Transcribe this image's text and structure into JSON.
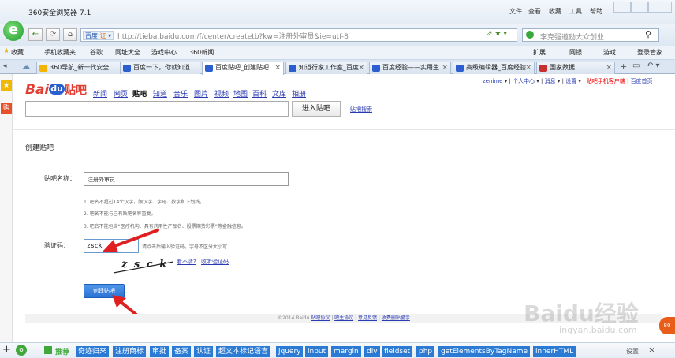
{
  "browser": {
    "title": "360安全浏览器 7.1",
    "menu": [
      "文件",
      "查看",
      "收藏",
      "工具",
      "帮助"
    ],
    "address_prefix": "百度",
    "address_url": "http://tieba.baidu.com/f/center/createtb?kw=注册外审员&ie=utf-8",
    "search_text": "李克强邀励大众创业",
    "favorites": [
      "收藏",
      "手机收藏夹",
      "谷歌",
      "网址大全",
      "游戏中心",
      "360新闻"
    ],
    "fav_right": [
      "扩展",
      "网银",
      "游戏",
      "登录管家"
    ],
    "tabs": [
      {
        "label": "360导航_新一代安全",
        "active": false
      },
      {
        "label": "百度一下，你就知道",
        "active": false
      },
      {
        "label": "百度贴吧_创建贴吧",
        "active": true
      },
      {
        "label": "知道行家工作室_百度",
        "active": false
      },
      {
        "label": "百度经验——实用生",
        "active": false
      },
      {
        "label": "高级编辑器_百度经验",
        "active": false
      },
      {
        "label": "国家数据",
        "active": false
      }
    ]
  },
  "header": {
    "logo_bai": "Bai",
    "logo_du": "du",
    "logo_tieba": "贴吧",
    "user": "zenime",
    "links": [
      "个人中心",
      "消息",
      "设置"
    ],
    "red_link": "贴吧手机客户端",
    "home": "百度首页",
    "nav": [
      "新闻",
      "网页",
      "贴吧",
      "知道",
      "音乐",
      "图片",
      "视频",
      "地图",
      "百科",
      "文库",
      "相册"
    ],
    "active_nav": "贴吧",
    "enter_button": "进入贴吧",
    "search_link": "贴吧搜索"
  },
  "form": {
    "section_title": "创建贴吧",
    "name_label": "贴吧名称：",
    "name_value": "注册外审员",
    "rules": [
      "1. 吧名不超过14个汉字，限汉字、字母、数字和下划线。",
      "2. 吧名不能与已有贴吧名称重复。",
      "3. 吧名不能包含“医疗机构、具有药用性产品名、股票期货彩票”等金融信息。"
    ],
    "captcha_label": "验证码：",
    "captcha_value": "zsck",
    "captcha_hint": "请点击后输入验证码，字母不区分大小写",
    "captcha_image_text": "z s c k",
    "unclear_link": "看不清?",
    "listen_link": "收听验证码",
    "submit": "创建贴吧"
  },
  "footer": {
    "copyright": "©2014 Baidu",
    "links": [
      "贴吧协议",
      "吧主协议",
      "意见反馈",
      "收费删贴警示"
    ]
  },
  "statusbar": {
    "recommend": "推荐",
    "tags": [
      "奇迹归来",
      "注册商标",
      "审批",
      "备案",
      "认证",
      "超文本标记语言",
      "jquery",
      "input",
      "margin",
      "div",
      "fieldset",
      "php",
      "getElementsByTagName",
      "innerHTML"
    ],
    "settings": "设置"
  },
  "watermark": {
    "brand": "Baidu经验",
    "url": "jingyan.baidu.com"
  }
}
